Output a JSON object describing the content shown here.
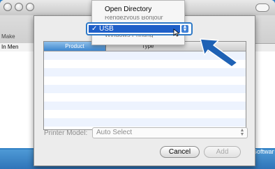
{
  "background_window": {
    "toolbar_label": "Make",
    "left_column_header": "In Men",
    "bottom_right_text": "Softwar"
  },
  "sheet": {
    "list_columns": [
      "Product",
      "Type"
    ],
    "printer_model_label": "Printer Model:",
    "printer_model_value": "Auto Select",
    "cancel_label": "Cancel",
    "add_label": "Add"
  },
  "menu": {
    "items": [
      "Open Directory",
      "USB"
    ],
    "selected": "USB",
    "checkmark": "✓"
  },
  "colors": {
    "accent": "#2e79c6",
    "selection": "#1f5fc8"
  },
  "icons": [
    "close-light-icon",
    "minimize-light-icon",
    "zoom-light-icon",
    "toolbar-pill-icon",
    "mouse-cursor-icon",
    "callout-arrow-icon",
    "stepper-arrows-icon"
  ]
}
